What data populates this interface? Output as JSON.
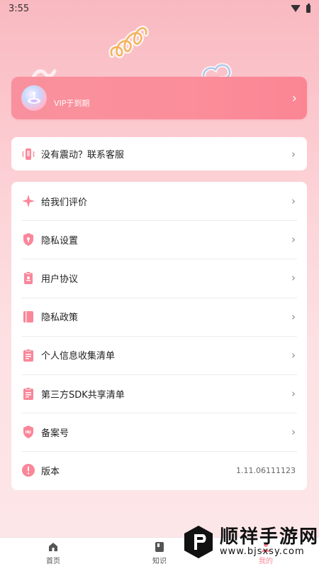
{
  "status_bar": {
    "time": "3:55"
  },
  "vip": {
    "text": "VIP于到期"
  },
  "contact": {
    "label": "没有震动？联系客服"
  },
  "menu": [
    {
      "label": "给我们评价",
      "icon": "star-sparkle-icon"
    },
    {
      "label": "隐私设置",
      "icon": "shield-lock-icon"
    },
    {
      "label": "用户协议",
      "icon": "agreement-icon"
    },
    {
      "label": "隐私政策",
      "icon": "book-icon"
    },
    {
      "label": "个人信息收集清单",
      "icon": "clipboard-list-icon"
    },
    {
      "label": "第三方SDK共享清单",
      "icon": "clipboard-share-icon"
    },
    {
      "label": "备案号",
      "icon": "icp-badge-icon"
    }
  ],
  "version": {
    "label": "版本",
    "value": "1.11.06111123"
  },
  "tabs": [
    {
      "label": "首页",
      "icon": "home-icon"
    },
    {
      "label": "知识",
      "icon": "knowledge-icon"
    },
    {
      "label": "我的",
      "icon": "profile-icon"
    }
  ],
  "watermark": {
    "title": "顺祥手游网",
    "subtitle": "www.bjsxsy.com"
  },
  "colors": {
    "accent": "#fb8c9a",
    "card": "#ffffff",
    "icon_pink": "#f98799"
  }
}
